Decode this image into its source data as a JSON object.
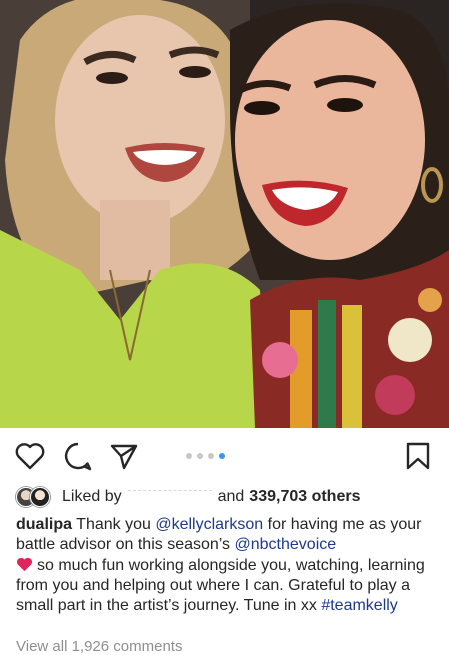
{
  "post": {
    "photo_alt": "",
    "carousel": {
      "count": 4,
      "active_index": 3
    },
    "likes": {
      "prefix": "Liked by",
      "middle": "and",
      "count_text": "339,703 others"
    },
    "caption": {
      "username": "dualipa",
      "part1": "Thank you",
      "mention1": "@kellyclarkson",
      "part2": "for having me as your battle advisor on this season’s",
      "mention2": "@nbcthevoice",
      "part3": "so much fun working alongside you, watching, learning from you and helping out where I can. Grateful to play a small part in the artist’s journey. Tune in xx",
      "hashtag": "#teamkelly"
    },
    "view_comments": "View all 1,926 comments"
  },
  "icons": {
    "like": "heart-outline-icon",
    "comment": "comment-bubble-icon",
    "share": "paper-plane-icon",
    "save": "bookmark-icon"
  },
  "colors": {
    "link": "#1f3a8a",
    "carousel_active": "#3897f0",
    "carousel_inactive": "#c7c7c7"
  }
}
